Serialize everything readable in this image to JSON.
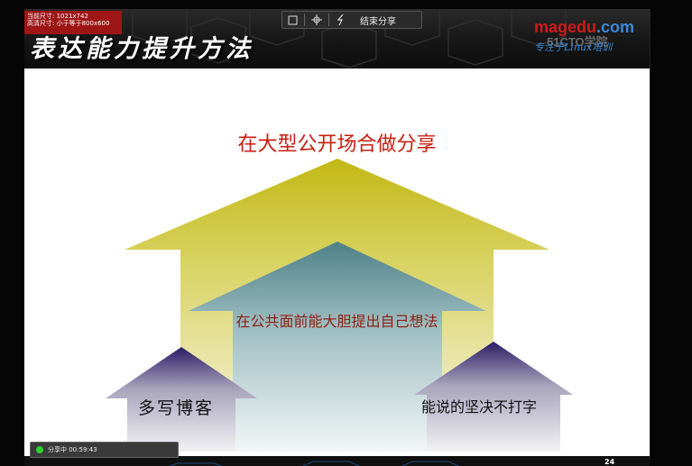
{
  "overlay": {
    "size_line1": "当前尺寸: 1021x742",
    "size_line2": "高清尺寸: 小于等于800x600"
  },
  "header": {
    "title": "表达能力提升方法",
    "logo_main": "magedu",
    "logo_tld": ".com",
    "logo_51": "51CTO学院",
    "logo_sub": "专注于Linux培训"
  },
  "toolbar": {
    "select_icon": "square-select-icon",
    "move_icon": "move-cross-icon",
    "draw_icon": "lightning-pen-icon",
    "end_share_label": "结束分享"
  },
  "slide": {
    "top_text": "在大型公开场合做分享",
    "middle_text": "在公共面前能大胆提出自己想法",
    "left_text": "多写博客",
    "right_text": "能说的坚决不打字",
    "page_number": "24"
  },
  "status": {
    "label": "分享中 00:59:43",
    "dot_color": "#2bd12b"
  },
  "colors": {
    "top_arrow": "#c8c020",
    "middle_arrow": "#5a8e98",
    "small_arrow": "#3a2a70",
    "text_red": "#c81e10"
  }
}
